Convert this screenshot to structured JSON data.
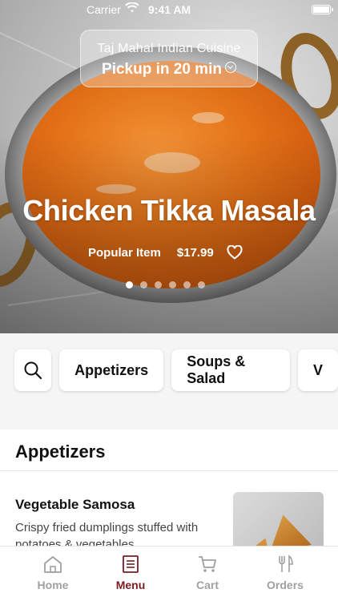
{
  "status_bar": {
    "carrier": "Carrier",
    "time": "9:41 AM"
  },
  "restaurant": {
    "name": "Taj Mahal Indian Cuisine",
    "pickup": "Pickup in 20 min"
  },
  "featured": {
    "title": "Chicken Tikka Masala",
    "tag": "Popular Item",
    "price": "$17.99",
    "carousel_count": 6,
    "carousel_active_index": 0
  },
  "categories": {
    "search_icon": "search-icon",
    "items": [
      "Appetizers",
      "Soups & Salad",
      "V"
    ]
  },
  "section": {
    "title": "Appetizers",
    "items": [
      {
        "name": "Vegetable Samosa",
        "description": "Crispy fried dumplings stuffed with potatoes & vegetables"
      }
    ]
  },
  "tabs": [
    {
      "label": "Home",
      "icon": "home-icon",
      "active": false
    },
    {
      "label": "Menu",
      "icon": "menu-icon",
      "active": true
    },
    {
      "label": "Cart",
      "icon": "cart-icon",
      "active": false
    },
    {
      "label": "Orders",
      "icon": "utensils-icon",
      "active": false
    }
  ],
  "colors": {
    "accent": "#7a1c24",
    "inactive_tab": "#a0a0a0"
  }
}
